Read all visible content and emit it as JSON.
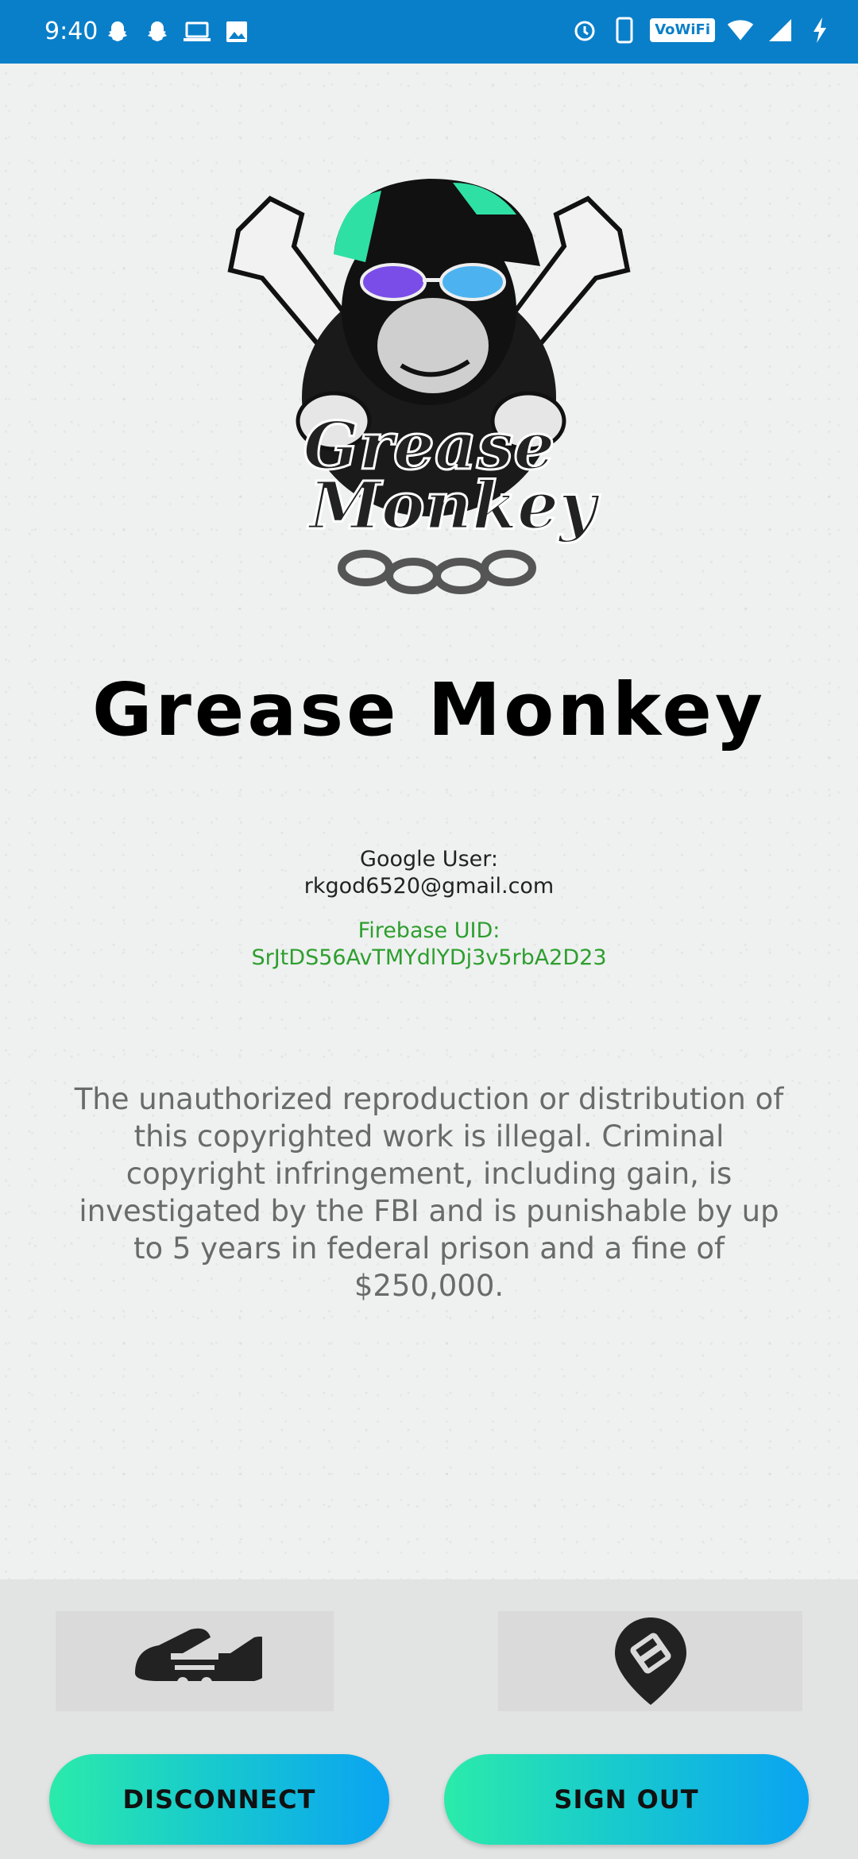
{
  "status_bar": {
    "time": "9:40",
    "left_icons": [
      "snapchat-icon",
      "snapchat-icon",
      "laptop-icon",
      "image-icon"
    ],
    "right_icons": [
      "alarm-icon",
      "phone-icon",
      "vowifi-icon",
      "wifi-icon",
      "signal-icon",
      "charging-icon"
    ],
    "vowifi_label": "VoWiFi"
  },
  "logo": {
    "line1": "Grease",
    "line2": "Monkey"
  },
  "app_title": "Grease Monkey",
  "google_user": {
    "label": "Google User:",
    "email": "rkgod6520@gmail.com"
  },
  "firebase": {
    "label": "Firebase UID:",
    "uid": "SrJtDS56AvTMYdlYDj3v5rbA2D23"
  },
  "warning_text": "The unauthorized reproduction or distribution of this copyrighted work is illegal. Criminal copyright infringement, including gain, is investigated by the FBI and is punishable by up to 5 years in federal prison and a fine of $250,000.",
  "actions": {
    "disconnect_label": "DISCONNECT",
    "sign_out_label": "SIGN OUT",
    "left_icon": "car-in-hands-icon",
    "right_icon": "car-location-pin-icon"
  },
  "colors": {
    "status_bar": "#0a7fc9",
    "uid_green": "#2e9e2e",
    "button_gradient_start": "#2bebaa",
    "button_gradient_end": "#0aa3f2"
  }
}
